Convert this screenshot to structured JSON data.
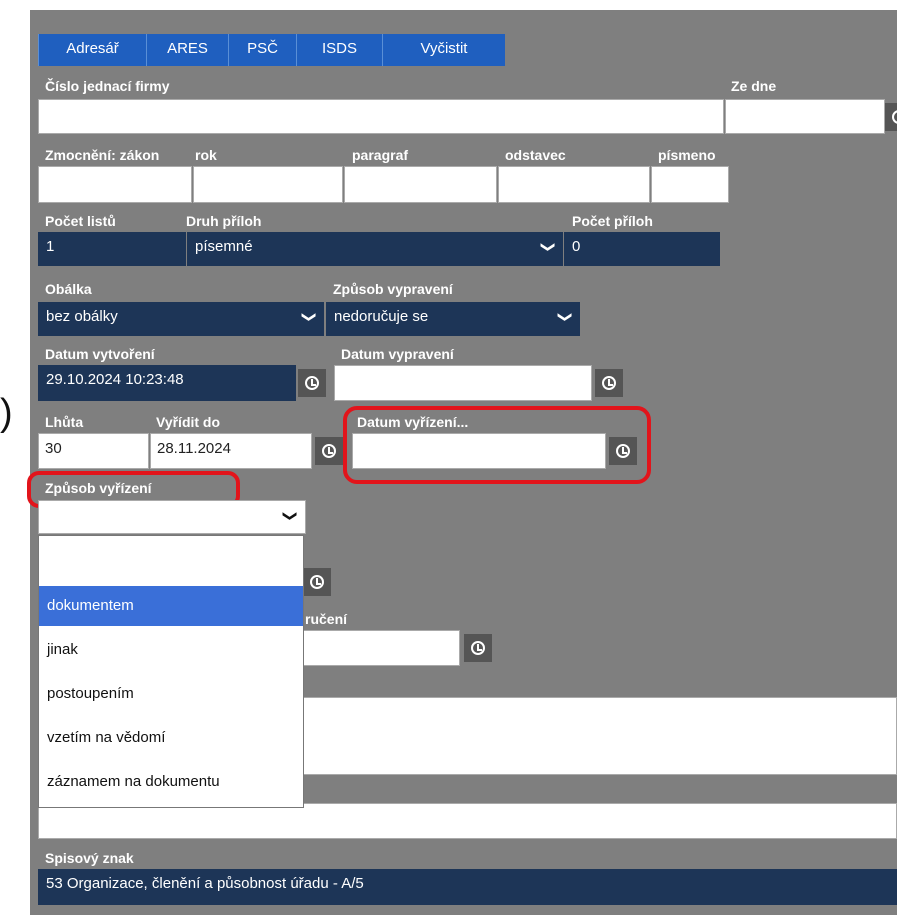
{
  "toolbar": {
    "buttons": [
      "Adresář",
      "ARES",
      "PSČ",
      "ISDS",
      "Vyčistit"
    ]
  },
  "form": {
    "cislo_jednaci_label": "Číslo jednací firmy",
    "ze_dne_label": "Ze dne",
    "zmocneni_label": "Zmocnění: zákon",
    "rok_label": "rok",
    "paragraf_label": "paragraf",
    "odstavec_label": "odstavec",
    "pismeno_label": "písmeno",
    "pocet_listu_label": "Počet listů",
    "pocet_listu_value": "1",
    "druh_priloh_label": "Druh příloh",
    "druh_priloh_value": "písemné",
    "pocet_priloh_label": "Počet příloh",
    "pocet_priloh_value": "0",
    "obalka_label": "Obálka",
    "obalka_value": "bez obálky",
    "zpusob_vypraveni_label": "Způsob vypravení",
    "zpusob_vypraveni_value": "nedoručuje se",
    "datum_vytvoreni_label": "Datum vytvoření",
    "datum_vytvoreni_value": "29.10.2024 10:23:48",
    "datum_vypraveni_label": "Datum vypravení",
    "lhuta_label": "Lhůta",
    "lhuta_value": "30",
    "vyridit_do_label": "Vyřídit do",
    "vyridit_do_value": "28.11.2024",
    "datum_vyrizeni_label": "Datum vyřízení...",
    "zpusob_vyrizeni_label": "Způsob vyřízení",
    "doruceni_label_fragment": "ručení",
    "spisovy_znak_label": "Spisový znak",
    "spisovy_znak_value": "53 Organizace, členění a působnost úřadu - A/5"
  },
  "dropdown": {
    "options": [
      "dokumentem",
      "jinak",
      "postoupením",
      "vzetím na vědomí",
      "záznamem na dokumentu"
    ],
    "selected_index": 0
  },
  "colors": {
    "panel": "#7f7f7f",
    "button": "#1f5fbf",
    "dark_field": "#1d3557",
    "annotation": "#e2141b",
    "selected_option": "#3a6fd8"
  }
}
